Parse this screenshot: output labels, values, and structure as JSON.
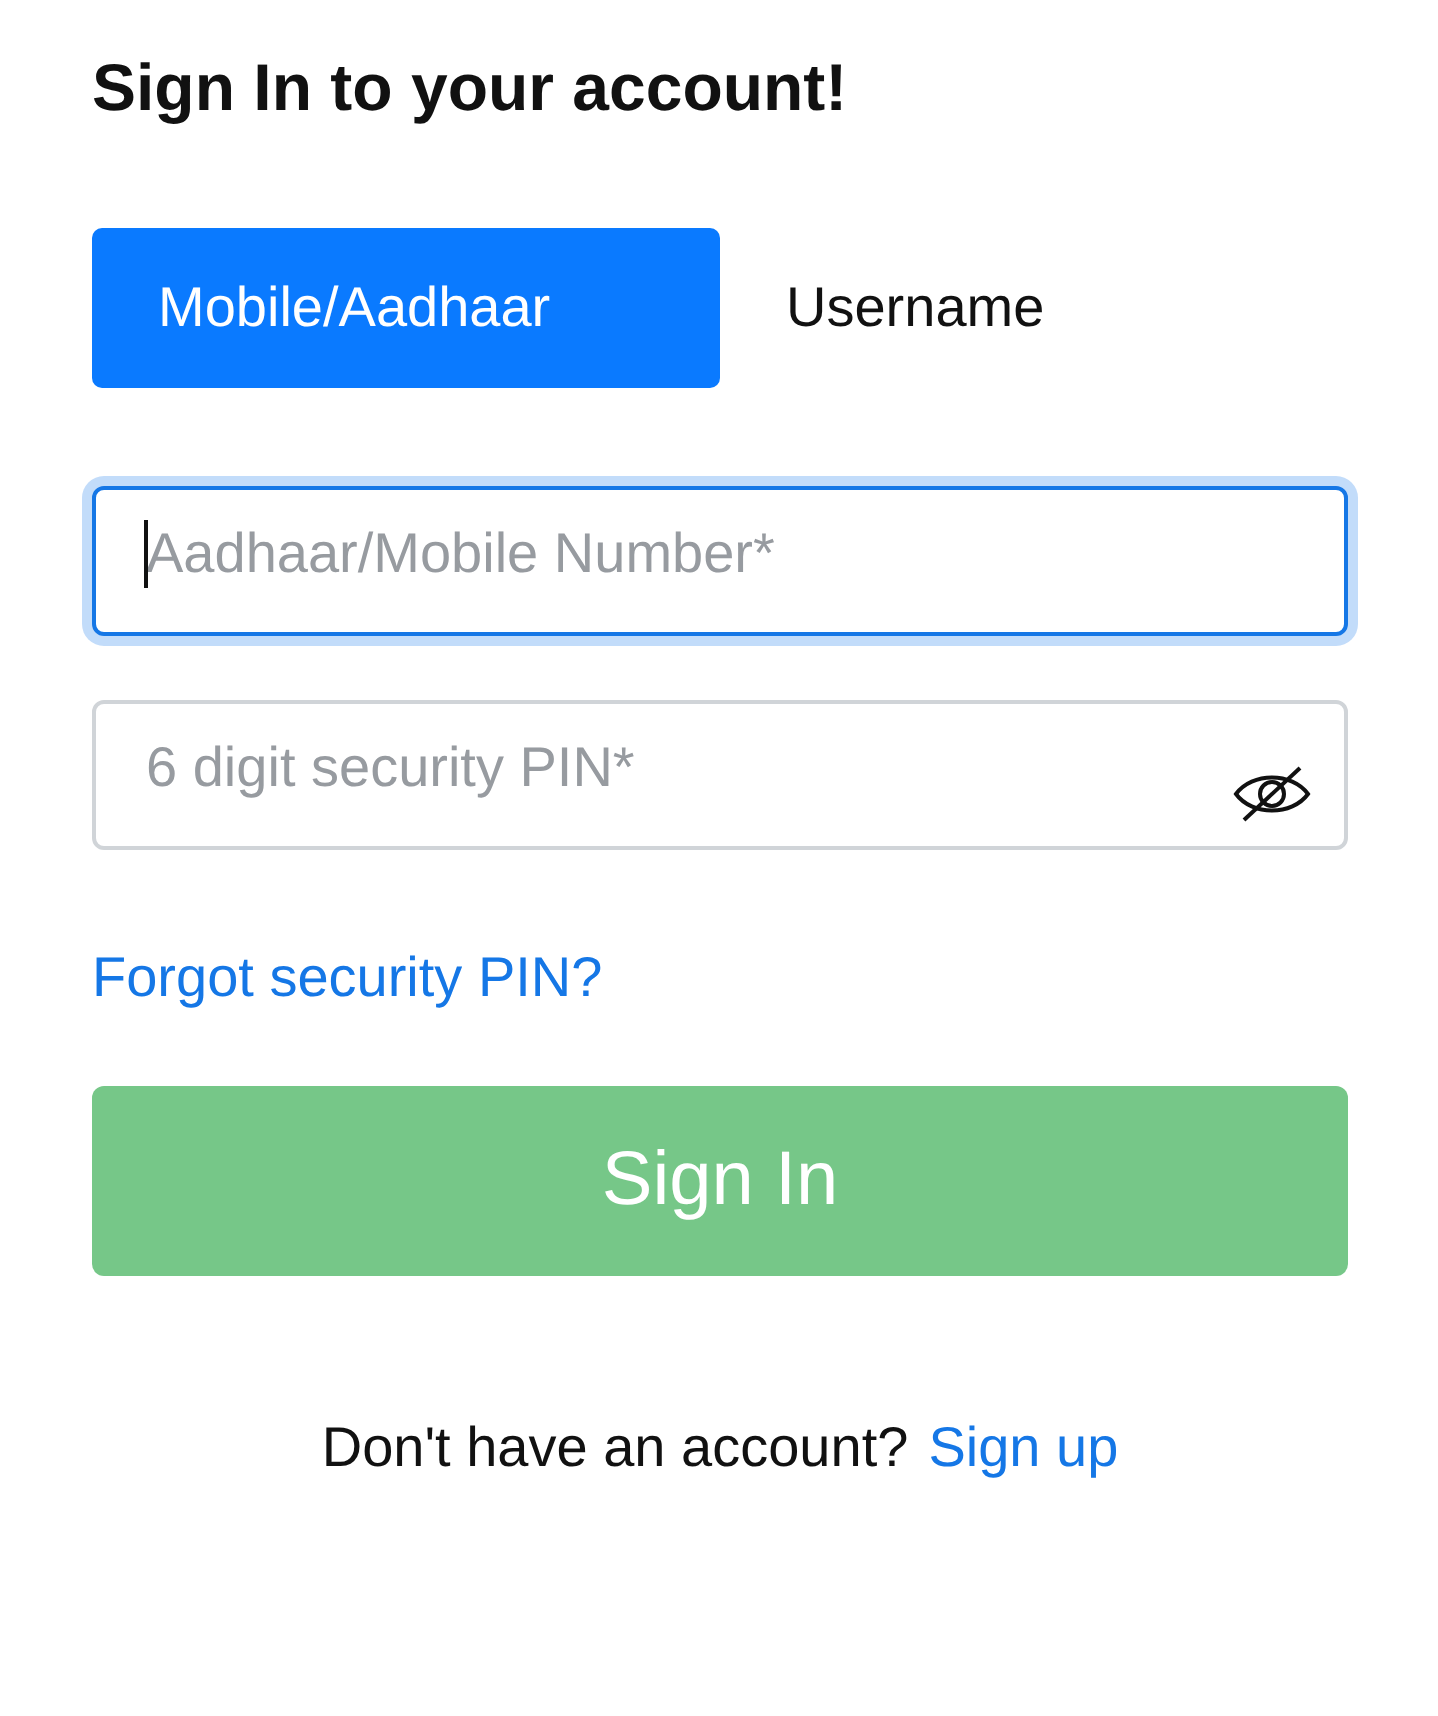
{
  "title": "Sign In to your account!",
  "tabs": [
    {
      "label": "Mobile/Aadhaar",
      "selected": true
    },
    {
      "label": "Username",
      "selected": false
    }
  ],
  "fields": [
    {
      "kind": "text",
      "placeholder": "Aadhaar/Mobile Number*",
      "focused": true
    },
    {
      "kind": "password",
      "placeholder": "6 digit security PIN*",
      "focused": false
    }
  ],
  "forgot_link": "Forgot security PIN?",
  "sign_in_button": "Sign In",
  "footer": {
    "text": "Don't have an account?",
    "link": "Sign up"
  }
}
